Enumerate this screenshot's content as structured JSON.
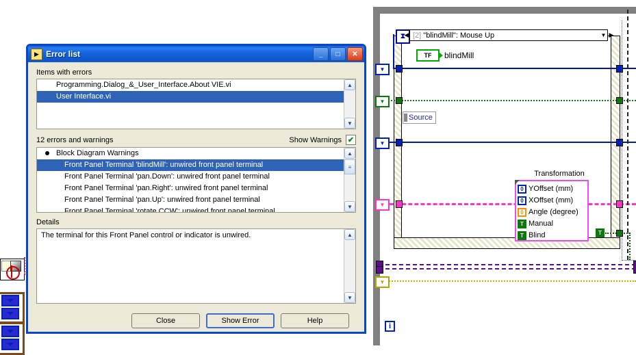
{
  "dialog": {
    "title": "Error list",
    "icon": "labview-vi-icon",
    "window_buttons": {
      "minimize": "_",
      "maximize": "□",
      "close": "✕"
    },
    "items_label": "Items with errors",
    "items": [
      {
        "text": "Programming.Dialog_&_User_Interface.About VIE.vi",
        "selected": false
      },
      {
        "text": "User Interface.vi",
        "selected": true
      }
    ],
    "count_text": "12 errors and warnings",
    "show_warnings_label": "Show Warnings",
    "show_warnings_checked": true,
    "checkmark": "✔",
    "warnings": [
      {
        "text": "Block Diagram Warnings",
        "group": true,
        "selected": false
      },
      {
        "text": "Front Panel Terminal 'blindMill': unwired front panel terminal",
        "group": false,
        "selected": true
      },
      {
        "text": "Front Panel Terminal 'pan.Down': unwired front panel terminal",
        "group": false,
        "selected": false
      },
      {
        "text": "Front Panel Terminal 'pan.Right': unwired front panel terminal",
        "group": false,
        "selected": false
      },
      {
        "text": "Front Panel Terminal 'pan.Up': unwired front panel terminal",
        "group": false,
        "selected": false
      },
      {
        "text": "Front Panel Terminal 'rotate.CCW': unwired front panel terminal",
        "group": false,
        "selected": false
      }
    ],
    "details_label": "Details",
    "details_text": "The terminal for this Front Panel control or indicator is unwired.",
    "buttons": {
      "close": "Close",
      "show_error": "Show Error",
      "help": "Help"
    },
    "scroll": {
      "up_arrow": "▲",
      "down_arrow": "▼",
      "thumb_grip": "≡"
    },
    "colors": {
      "titlebar": "#0e55c8",
      "dialog_bg": "#ece9d8",
      "selection": "#2f63b5",
      "check_green": "#0a8a0a"
    }
  },
  "block_diagram": {
    "event_case_label_index": "[2]",
    "event_case_label": "\"blindMill\": Mouse Up",
    "event_prev_arrow": "◀",
    "event_next_arrow": "▶",
    "event_dropdown_arrow": "▼",
    "timeout_icon": "hourglass-icon",
    "timeout_glyph": "⧗",
    "boolean_constant": {
      "value": "TF",
      "label": "blindMill"
    },
    "source_label": "Source",
    "iteration_terminal": "i",
    "transformation": {
      "title": "Transformation",
      "fields": [
        {
          "glyph": "0",
          "type": "numeric",
          "label": "YOffset (mm)",
          "color": "#0022bb"
        },
        {
          "glyph": "0",
          "type": "numeric",
          "label": "XOffset (mm)",
          "color": "#0022bb"
        },
        {
          "glyph": "0",
          "type": "numeric",
          "label": "Angle (degree)",
          "color": "#ff8c00"
        },
        {
          "glyph": "T",
          "type": "boolean",
          "label": "Manual",
          "color": "#0a7a0a"
        },
        {
          "glyph": "T",
          "type": "boolean",
          "label": "Blind",
          "color": "#0a7a0a"
        }
      ]
    },
    "standalone_boolean": "T",
    "wire_colors": {
      "blue": "#001a9c",
      "green": "#0a7a0a",
      "pink": "#ff33cc",
      "purple": "#5b0f8b",
      "yellow": "#c8b400"
    }
  }
}
